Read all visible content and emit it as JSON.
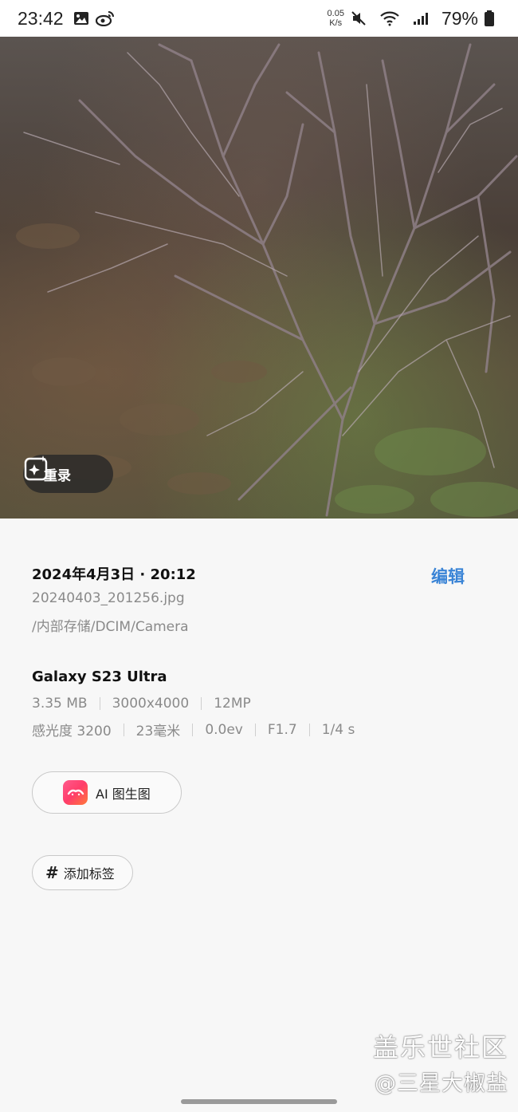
{
  "status_bar": {
    "time": "23:42",
    "speed_value": "0.05",
    "speed_unit": "K/s",
    "battery": "79%",
    "icons": [
      "gallery-icon",
      "weibo-icon",
      "mute-icon",
      "wifi-icon",
      "signal-icon",
      "battery-icon"
    ]
  },
  "photo": {
    "remaster_label": "重录"
  },
  "details": {
    "datetime": "2024年4月3日 · 20:12",
    "edit_label": "编辑",
    "filename": "20240403_201256.jpg",
    "path": "/内部存储/DCIM/Camera",
    "device": "Galaxy S23 Ultra",
    "file_specs": [
      "3.35 MB",
      "3000x4000",
      "12MP"
    ],
    "camera_specs": [
      "感光度 3200",
      "23毫米",
      "0.0ev",
      "F1.7",
      "1/4 s"
    ]
  },
  "actions": {
    "ai_label": "AI 图生图",
    "tag_symbol": "#",
    "tag_label": "添加标签"
  },
  "watermark": {
    "line1": "盖乐世社区",
    "line2": "@三星大椒盐"
  },
  "colors": {
    "accent": "#3a84d6",
    "background": "#f7f7f7"
  }
}
